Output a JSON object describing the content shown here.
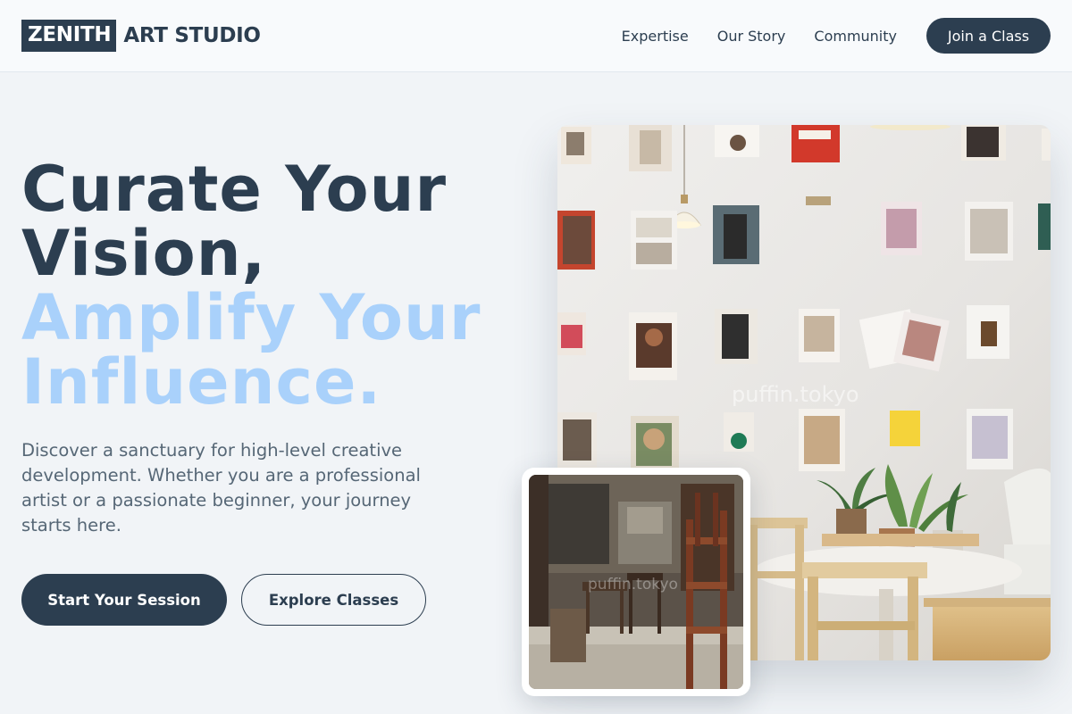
{
  "brand": {
    "box_text": "ZENITH",
    "text": "ART STUDIO"
  },
  "nav": {
    "links": [
      "Expertise",
      "Our Story",
      "Community"
    ],
    "cta": "Join a Class"
  },
  "hero": {
    "headline_dark_1": "Curate Your",
    "headline_dark_2": "Vision,",
    "headline_light_1": "Amplify Your",
    "headline_light_2": "Influence.",
    "description": "Discover a sanctuary for high-level creative development. Whether you are a professional artist or a passionate beginner, your journey starts here.",
    "primary_button": "Start Your Session",
    "secondary_button": "Explore Classes"
  },
  "images": {
    "main_watermark": "puffin.tokyo",
    "inset_watermark": "puffin.tokyo"
  },
  "colors": {
    "primary": "#2c3e50",
    "accent_light": "#a9d1fb",
    "background": "#f1f4f7",
    "muted_text": "#566776"
  }
}
